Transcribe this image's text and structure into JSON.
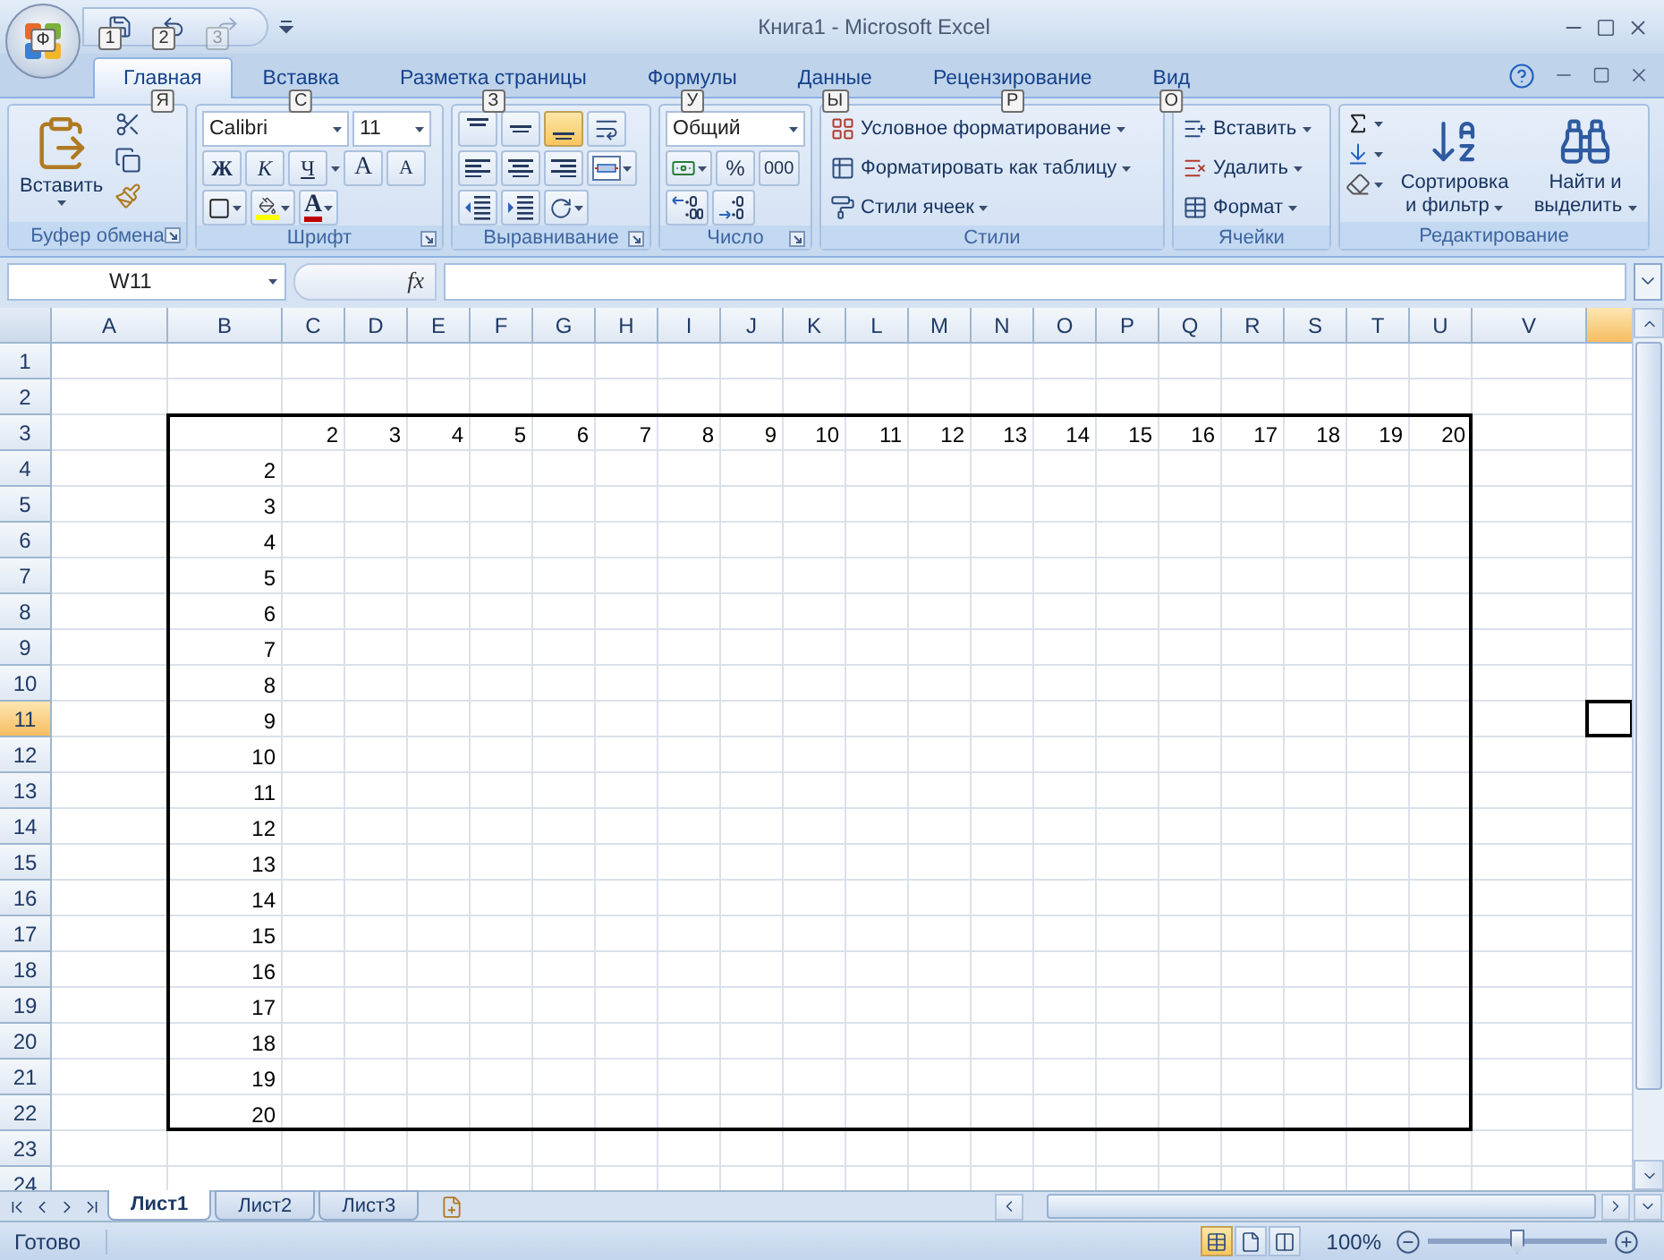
{
  "window": {
    "title": "Книга1 - Microsoft Excel"
  },
  "office_button": {
    "key_tip": "Ф"
  },
  "quick_access": [
    {
      "kind": "save",
      "key_tip": "1",
      "disabled": false
    },
    {
      "kind": "undo",
      "key_tip": "2",
      "disabled": false
    },
    {
      "kind": "redo",
      "key_tip": "3",
      "disabled": true
    }
  ],
  "tabs": [
    {
      "label": "Главная",
      "key_tip": "Я",
      "selected": true
    },
    {
      "label": "Вставка",
      "key_tip": "С",
      "selected": false
    },
    {
      "label": "Разметка страницы",
      "key_tip": "З",
      "selected": false
    },
    {
      "label": "Формулы",
      "key_tip": "У",
      "selected": false
    },
    {
      "label": "Данные",
      "key_tip": "Ы",
      "selected": false
    },
    {
      "label": "Рецензирование",
      "key_tip": "Р",
      "selected": false
    },
    {
      "label": "Вид",
      "key_tip": "О",
      "selected": false
    }
  ],
  "ribbon": {
    "clipboard": {
      "label": "Буфер обмена",
      "paste": "Вставить"
    },
    "font": {
      "label": "Шрифт",
      "font_name": "Calibri",
      "font_size": "11",
      "styles": [
        "Ж",
        "К",
        "Ч"
      ],
      "grow": "A",
      "shrink": "A",
      "font_color": "A"
    },
    "alignment": {
      "label": "Выравнивание",
      "vertical": [
        {
          "selected": false
        },
        {
          "selected": false
        },
        {
          "selected": true
        }
      ],
      "horizontal": [
        {
          "selected": false
        },
        {
          "selected": false
        },
        {
          "selected": false
        }
      ]
    },
    "number": {
      "label": "Число",
      "format": "Общий",
      "percent": "%",
      "thousands": "000"
    },
    "styles": {
      "label": "Стили",
      "items": [
        {
          "kind": "conditional",
          "label": "Условное форматирование"
        },
        {
          "kind": "table",
          "label": "Форматировать как таблицу"
        },
        {
          "kind": "cell",
          "label": "Стили ячеек"
        }
      ]
    },
    "cells": {
      "label": "Ячейки",
      "items": [
        {
          "kind": "insert",
          "label": "Вставить"
        },
        {
          "kind": "delete",
          "label": "Удалить"
        },
        {
          "kind": "format",
          "label": "Формат"
        }
      ]
    },
    "editing": {
      "label": "Редактирование",
      "sort": "Сортировка и фильтр",
      "find": "Найти и выделить"
    }
  },
  "name_box": "W11",
  "formula_icon": "fx",
  "columns": [
    {
      "label": "A",
      "selected": false
    },
    {
      "label": "B",
      "selected": false
    },
    {
      "label": "C",
      "selected": false
    },
    {
      "label": "D",
      "selected": false
    },
    {
      "label": "E",
      "selected": false
    },
    {
      "label": "F",
      "selected": false
    },
    {
      "label": "G",
      "selected": false
    },
    {
      "label": "H",
      "selected": false
    },
    {
      "label": "I",
      "selected": false
    },
    {
      "label": "J",
      "selected": false
    },
    {
      "label": "K",
      "selected": false
    },
    {
      "label": "L",
      "selected": false
    },
    {
      "label": "M",
      "selected": false
    },
    {
      "label": "N",
      "selected": false
    },
    {
      "label": "O",
      "selected": false
    },
    {
      "label": "P",
      "selected": false
    },
    {
      "label": "Q",
      "selected": false
    },
    {
      "label": "R",
      "selected": false
    },
    {
      "label": "S",
      "selected": false
    },
    {
      "label": "T",
      "selected": false
    },
    {
      "label": "U",
      "selected": false
    },
    {
      "label": "V",
      "selected": false
    },
    {
      "selected": true
    }
  ],
  "rows": [
    {
      "label": "1",
      "selected": false
    },
    {
      "label": "2",
      "selected": false
    },
    {
      "label": "3",
      "selected": false
    },
    {
      "label": "4",
      "selected": false
    },
    {
      "label": "5",
      "selected": false
    },
    {
      "label": "6",
      "selected": false
    },
    {
      "label": "7",
      "selected": false
    },
    {
      "label": "8",
      "selected": false
    },
    {
      "label": "9",
      "selected": false
    },
    {
      "label": "10",
      "selected": false
    },
    {
      "label": "11",
      "selected": true
    },
    {
      "label": "12",
      "selected": false
    },
    {
      "label": "13",
      "selected": false
    },
    {
      "label": "14",
      "selected": false
    },
    {
      "label": "15",
      "selected": false
    },
    {
      "label": "16",
      "selected": false
    },
    {
      "label": "17",
      "selected": false
    },
    {
      "label": "18",
      "selected": false
    },
    {
      "label": "19",
      "selected": false
    },
    {
      "label": "20",
      "selected": false
    },
    {
      "label": "21",
      "selected": false
    },
    {
      "label": "22",
      "selected": false
    },
    {
      "label": "23",
      "selected": false
    },
    {
      "label": "24",
      "selected": false
    }
  ],
  "table": {
    "column_headers": [
      "2",
      "3",
      "4",
      "5",
      "6",
      "7",
      "8",
      "9",
      "10",
      "11",
      "12",
      "13",
      "14",
      "15",
      "16",
      "17",
      "18",
      "19",
      "20"
    ],
    "row_headers": [
      "2",
      "3",
      "4",
      "5",
      "6",
      "7",
      "8",
      "9",
      "10",
      "11",
      "12",
      "13",
      "14",
      "15",
      "16",
      "17",
      "18",
      "19",
      "20"
    ]
  },
  "sheet_tabs": [
    {
      "label": "Лист1",
      "selected": true
    },
    {
      "label": "Лист2",
      "selected": false
    },
    {
      "label": "Лист3",
      "selected": false
    }
  ],
  "status_bar": {
    "status": "Готово",
    "views": [
      {
        "kind": "normal",
        "selected": true
      },
      {
        "kind": "page_layout",
        "selected": false
      },
      {
        "kind": "page_break",
        "selected": false
      }
    ],
    "zoom": "100%",
    "zoom_slider": {
      "level": 0.5
    }
  }
}
